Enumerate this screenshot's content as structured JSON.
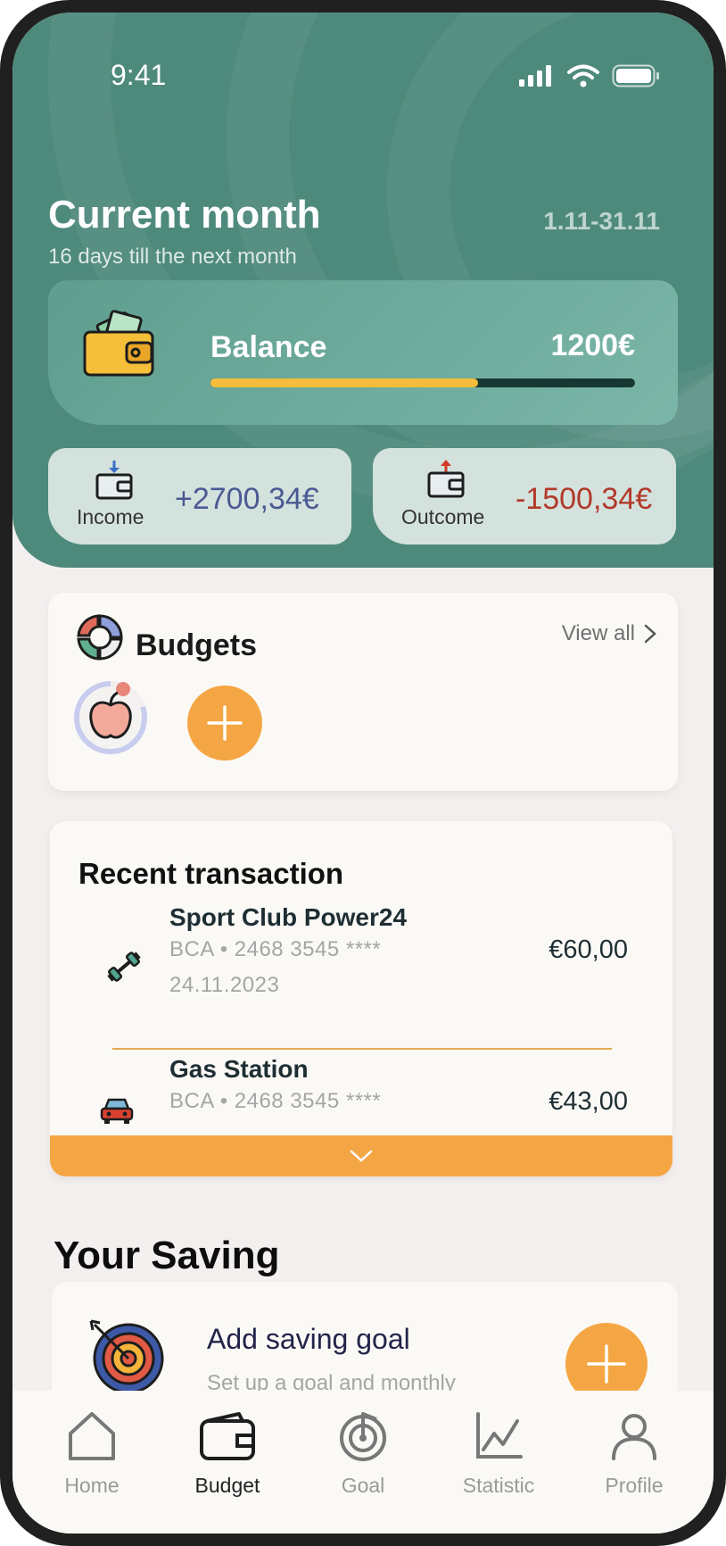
{
  "status_bar": {
    "time": "9:41"
  },
  "header": {
    "title": "Current month",
    "subtitle": "16 days till the next month",
    "date_range": "1.11-31.11"
  },
  "balance": {
    "label": "Balance",
    "value": "1200€",
    "progress": 0.63
  },
  "income": {
    "label": "Income",
    "value": "+2700,34€"
  },
  "outcome": {
    "label": "Outcome",
    "value": "-1500,34€"
  },
  "budgets": {
    "title": "Budgets",
    "view_all": "View all"
  },
  "transactions": {
    "title": "Recent transaction",
    "items": [
      {
        "name": "Sport Club Power24",
        "account": "BCA • 2468 3545 ****",
        "date": "24.11.2023",
        "amount": "€60,00",
        "icon": "dumbbell-icon"
      },
      {
        "name": "Gas Station",
        "account": "BCA • 2468 3545 ****",
        "amount": "€43,00",
        "icon": "car-icon"
      }
    ]
  },
  "saving": {
    "title": "Your Saving",
    "add_label": "Add saving goal",
    "add_sub": "Set up a goal and monthly"
  },
  "tabs": [
    {
      "label": "Home",
      "icon": "home-icon"
    },
    {
      "label": "Budget",
      "icon": "wallet-icon",
      "active": true
    },
    {
      "label": "Goal",
      "icon": "target-icon"
    },
    {
      "label": "Statistic",
      "icon": "chart-icon"
    },
    {
      "label": "Profile",
      "icon": "user-icon"
    }
  ],
  "colors": {
    "header": "#4e8a7c",
    "accent": "#f5a644",
    "income": "#4a5a92",
    "outcome": "#b2392a"
  }
}
